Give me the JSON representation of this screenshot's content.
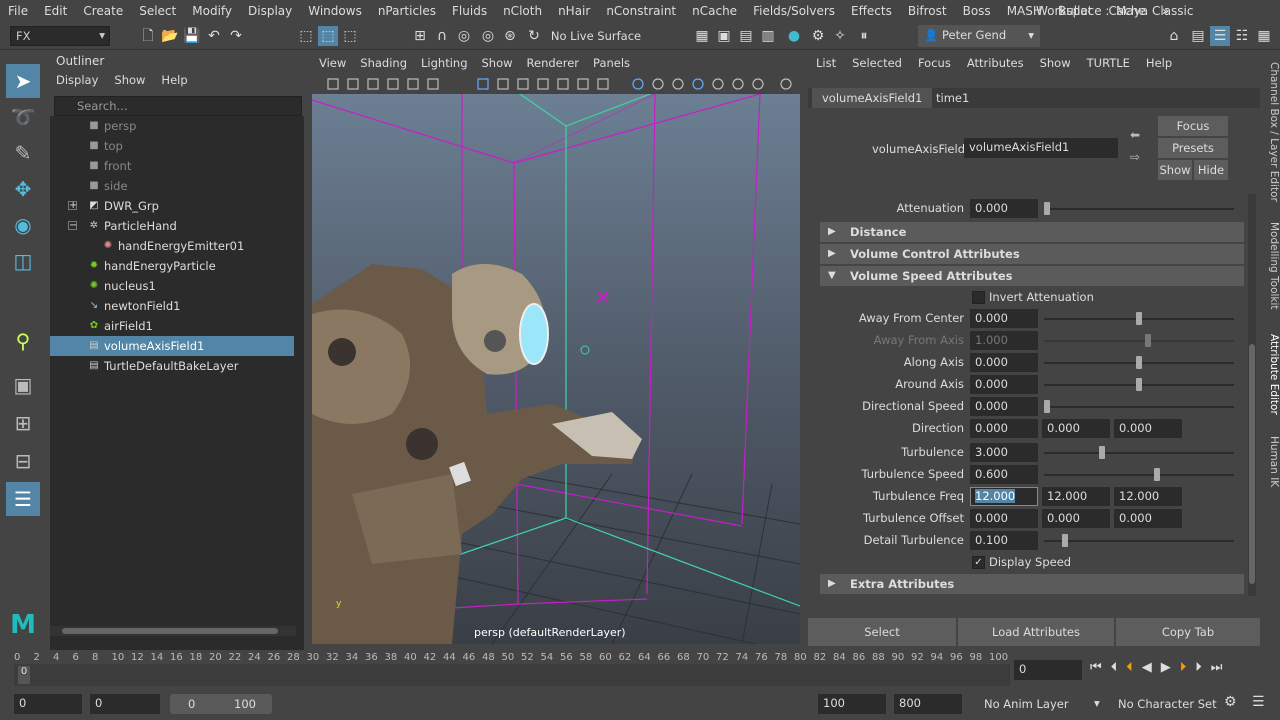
{
  "menubar": {
    "items": [
      "File",
      "Edit",
      "Create",
      "Select",
      "Modify",
      "Display",
      "Windows",
      "nParticles",
      "Fluids",
      "nCloth",
      "nHair",
      "nConstraint",
      "nCache",
      "Fields/Solvers",
      "Effects",
      "Bifrost",
      "Boss",
      "MASH",
      "Bullet",
      "Cache",
      "»"
    ],
    "workspace_label": "Workspace :",
    "workspace_value": "Maya Classic"
  },
  "toolbar": {
    "menu_set": "FX",
    "live_surface": "No Live Surface",
    "user": "Peter Gend"
  },
  "outliner": {
    "title": "Outliner",
    "menu": [
      "Display",
      "Show",
      "Help"
    ],
    "search_placeholder": "Search...",
    "items": [
      {
        "label": "persp",
        "icon": "camera-icon",
        "indent": 1,
        "dim": true
      },
      {
        "label": "top",
        "icon": "camera-icon",
        "indent": 1,
        "dim": true
      },
      {
        "label": "front",
        "icon": "camera-icon",
        "indent": 1,
        "dim": true
      },
      {
        "label": "side",
        "icon": "camera-icon",
        "indent": 1,
        "dim": true
      },
      {
        "label": "DWR_Grp",
        "icon": "group-icon",
        "indent": 1,
        "expand": "+"
      },
      {
        "label": "ParticleHand",
        "icon": "transform-icon",
        "indent": 1,
        "expand": "−"
      },
      {
        "label": "handEnergyEmitter01",
        "icon": "emitter-icon",
        "indent": 2
      },
      {
        "label": "handEnergyParticle",
        "icon": "particle-icon",
        "indent": 1
      },
      {
        "label": "nucleus1",
        "icon": "nucleus-icon",
        "indent": 1
      },
      {
        "label": "newtonField1",
        "icon": "newton-icon",
        "indent": 1
      },
      {
        "label": "airField1",
        "icon": "air-field-icon",
        "indent": 1
      },
      {
        "label": "volumeAxisField1",
        "icon": "volume-field-icon",
        "indent": 1,
        "selected": true
      },
      {
        "label": "TurtleDefaultBakeLayer",
        "icon": "bake-layer-icon",
        "indent": 1
      }
    ]
  },
  "viewport": {
    "menu": [
      "View",
      "Shading",
      "Lighting",
      "Show",
      "Renderer",
      "Panels"
    ],
    "camera_label": "persp (defaultRenderLayer)"
  },
  "attribute_editor": {
    "menu": [
      "List",
      "Selected",
      "Focus",
      "Attributes",
      "Show",
      "TURTLE",
      "Help"
    ],
    "tabs": [
      "volumeAxisField1",
      "time1"
    ],
    "node_label": "volumeAxisField:",
    "node_value": "volumeAxisField1",
    "focus_btn": "Focus",
    "presets_btn": "Presets",
    "show_btn": "Show",
    "hide_btn": "Hide",
    "attenuation_label": "Attenuation",
    "attenuation_value": "0.000",
    "frames": {
      "distance": "Distance",
      "volume_control": "Volume Control Attributes",
      "volume_speed": "Volume Speed Attributes",
      "extra": "Extra Attributes"
    },
    "invert_attenuation": "Invert Attenuation",
    "rows": {
      "away_from_center": {
        "label": "Away From Center",
        "value": "0.000",
        "slider": 0.5
      },
      "away_from_axis": {
        "label": "Away From Axis",
        "value": "1.000",
        "slider": 0.55,
        "disabled": true
      },
      "along_axis": {
        "label": "Along Axis",
        "value": "0.000",
        "slider": 0.5
      },
      "around_axis": {
        "label": "Around Axis",
        "value": "0.000",
        "slider": 0.5
      },
      "directional_speed": {
        "label": "Directional Speed",
        "value": "0.000",
        "slider": 0.0
      },
      "direction": {
        "label": "Direction",
        "values": [
          "0.000",
          "0.000",
          "0.000"
        ]
      },
      "turbulence": {
        "label": "Turbulence",
        "value": "3.000",
        "slider": 0.3
      },
      "turbulence_speed": {
        "label": "Turbulence Speed",
        "value": "0.600",
        "slider": 0.6
      },
      "turbulence_freq": {
        "label": "Turbulence Freq",
        "values": [
          "12.000",
          "12.000",
          "12.000"
        ]
      },
      "turbulence_offset": {
        "label": "Turbulence Offset",
        "values": [
          "0.000",
          "0.000",
          "0.000"
        ]
      },
      "detail_turbulence": {
        "label": "Detail Turbulence",
        "value": "0.100",
        "slider": 0.1
      }
    },
    "display_speed": "Display Speed",
    "select_btn": "Select",
    "load_attributes_btn": "Load Attributes",
    "copy_tab_btn": "Copy Tab"
  },
  "side_tabs": [
    "Channel Box / Layer Editor",
    "Modelling Toolkit",
    "Attribute Editor",
    "Human IK"
  ],
  "timeline": {
    "ticks": [
      "0",
      "2",
      "4",
      "6",
      "8",
      "10",
      "12",
      "14",
      "16",
      "18",
      "20",
      "22",
      "24",
      "26",
      "28",
      "30",
      "32",
      "34",
      "36",
      "38",
      "40",
      "42",
      "44",
      "46",
      "48",
      "50",
      "52",
      "54",
      "56",
      "58",
      "60",
      "62",
      "64",
      "66",
      "68",
      "70",
      "72",
      "74",
      "76",
      "78",
      "80",
      "82",
      "84",
      "86",
      "88",
      "90",
      "92",
      "94",
      "96",
      "98",
      "100"
    ],
    "current_frame": "0",
    "frame_field": "0"
  },
  "range": {
    "start": "0",
    "playback_start": "0",
    "slider_start": "0",
    "slider_end": "100",
    "playback_end": "100",
    "end": "800",
    "anim_layer": "No Anim Layer",
    "character_set": "No Character Set"
  }
}
